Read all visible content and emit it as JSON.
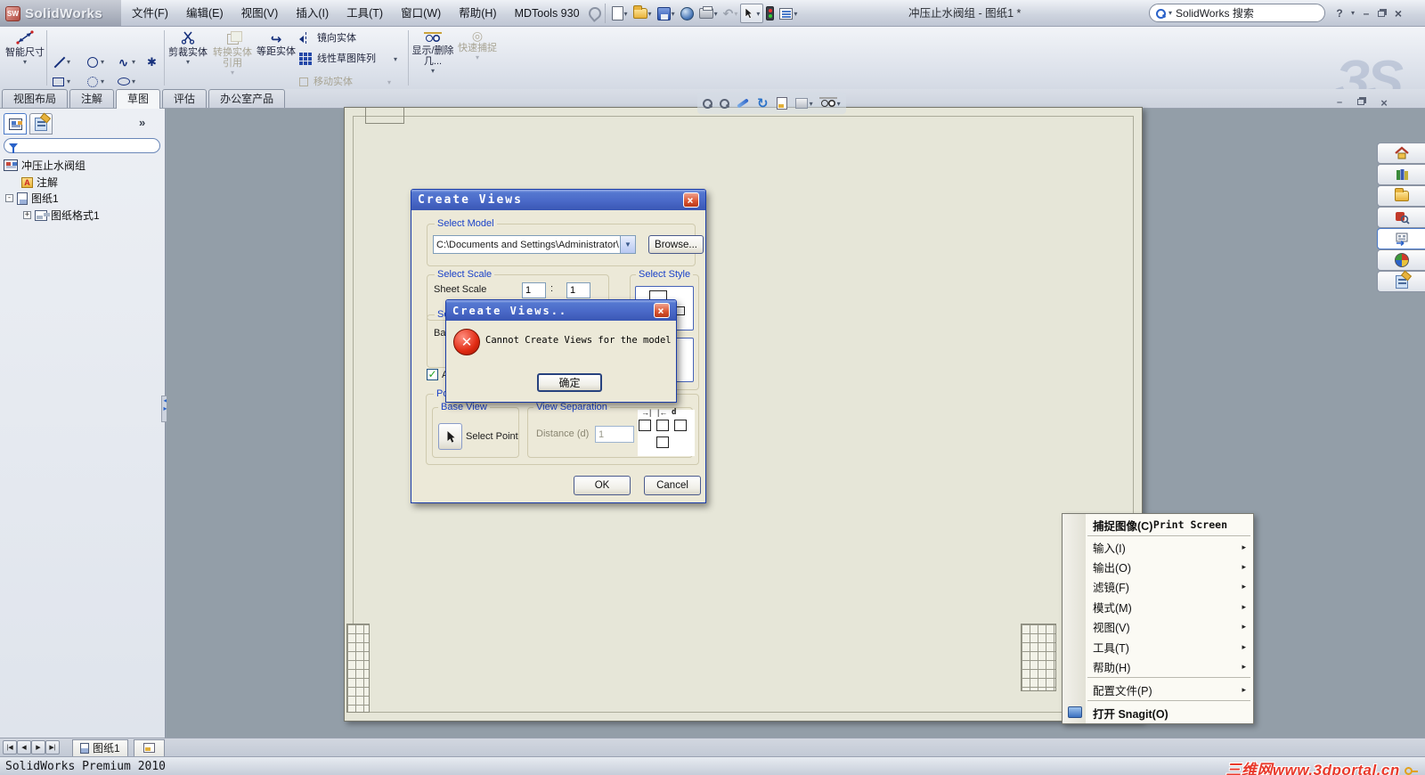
{
  "window": {
    "logo_text": "SolidWorks",
    "logo_cube": "SW",
    "doc_title": "冲压止水阀组 - 图纸1 *",
    "search_value": "SolidWorks 搜索",
    "help_label": "?"
  },
  "menubar": {
    "items": [
      "文件(F)",
      "编辑(E)",
      "视图(V)",
      "插入(I)",
      "工具(T)",
      "窗口(W)",
      "帮助(H)",
      "MDTools 930"
    ]
  },
  "quick_toolbar": {
    "icons": [
      "new",
      "open",
      "save",
      "appearance",
      "print",
      "undo",
      "select",
      "rebuild",
      "options"
    ]
  },
  "ribbon": {
    "smart_dimension": "智能尺寸",
    "trim_entities": "剪裁实体",
    "convert_entities": "转换实体引用",
    "offset_entities": "等距实体",
    "mirror_entities": "镜向实体",
    "linear_sketch_pattern": "线性草图阵列",
    "move_entities": "移动实体",
    "display_delete_relations": "显示/删除几...",
    "quick_snaps": "快速捕捉",
    "brand_watermark": "ЗS"
  },
  "command_tabs": {
    "items": [
      "视图布局",
      "注解",
      "草图",
      "评估",
      "办公室产品"
    ],
    "active_index": 2,
    "expand_toggle": "»"
  },
  "feature_tree": {
    "root": "冲压止水阀组",
    "nodes": [
      {
        "label": "注解"
      },
      {
        "label": "图纸1",
        "expander": "-"
      },
      {
        "label": "图纸格式1",
        "expander": "+"
      }
    ]
  },
  "heads_up_toolbar": {
    "icons": [
      "zoom-fit",
      "zoom-area",
      "previous-view",
      "rotate-view",
      "update-sheet",
      "view-orientation",
      "display-style"
    ]
  },
  "task_pane": {
    "icons": [
      "solidworks-resources",
      "design-library",
      "file-explorer",
      "search",
      "view-palette",
      "appearances",
      "custom-properties"
    ]
  },
  "create_views_dialog": {
    "title": "Create Views",
    "select_model": {
      "label": "Select Model",
      "path_value": "C:\\Documents and Settings\\Administrator\\",
      "browse": "Browse..."
    },
    "select_scale": {
      "label": "Select Scale",
      "sheet_scale_label": "Sheet Scale",
      "numerator": "1",
      "separator": ":",
      "denominator": "1"
    },
    "select_style": {
      "label": "Select Style"
    },
    "covered_fragments": {
      "group_label": "Sel",
      "field_text": "Ba",
      "checkbox_label": "A"
    },
    "position_views": {
      "label": "Position Views",
      "base_view_label": "Base View",
      "select_point": "Select Point",
      "view_separation_label": "View Separation",
      "distance_label": "Distance (d)",
      "distance_value": "1",
      "dim_letter": "d"
    },
    "ok": "OK",
    "cancel": "Cancel"
  },
  "error_dialog": {
    "title": "Create Views..",
    "message": "Cannot Create Views for the model",
    "ok": "确定"
  },
  "context_menu": {
    "items": [
      {
        "label": "捕捉图像(C)",
        "shortcut": "Print Screen"
      },
      {
        "label": "输入(I)"
      },
      {
        "label": "输出(O)"
      },
      {
        "label": "滤镜(F)"
      },
      {
        "label": "模式(M)"
      },
      {
        "label": "视图(V)"
      },
      {
        "label": "工具(T)"
      },
      {
        "label": "帮助(H)"
      },
      {
        "label": "配置文件(P)"
      },
      {
        "label": "打开 Snagit(O)"
      }
    ]
  },
  "sheet_tabs": {
    "active": "图纸1"
  },
  "status_bar": {
    "text": "SolidWorks Premium 2010",
    "watermark": "三维网www.3dportal.cn"
  },
  "colors": {
    "xp_title_blue": "#4a69c8",
    "group_label_blue": "#1a41c8",
    "error_red": "#d92a12",
    "watermark_red": "#e8392b"
  }
}
